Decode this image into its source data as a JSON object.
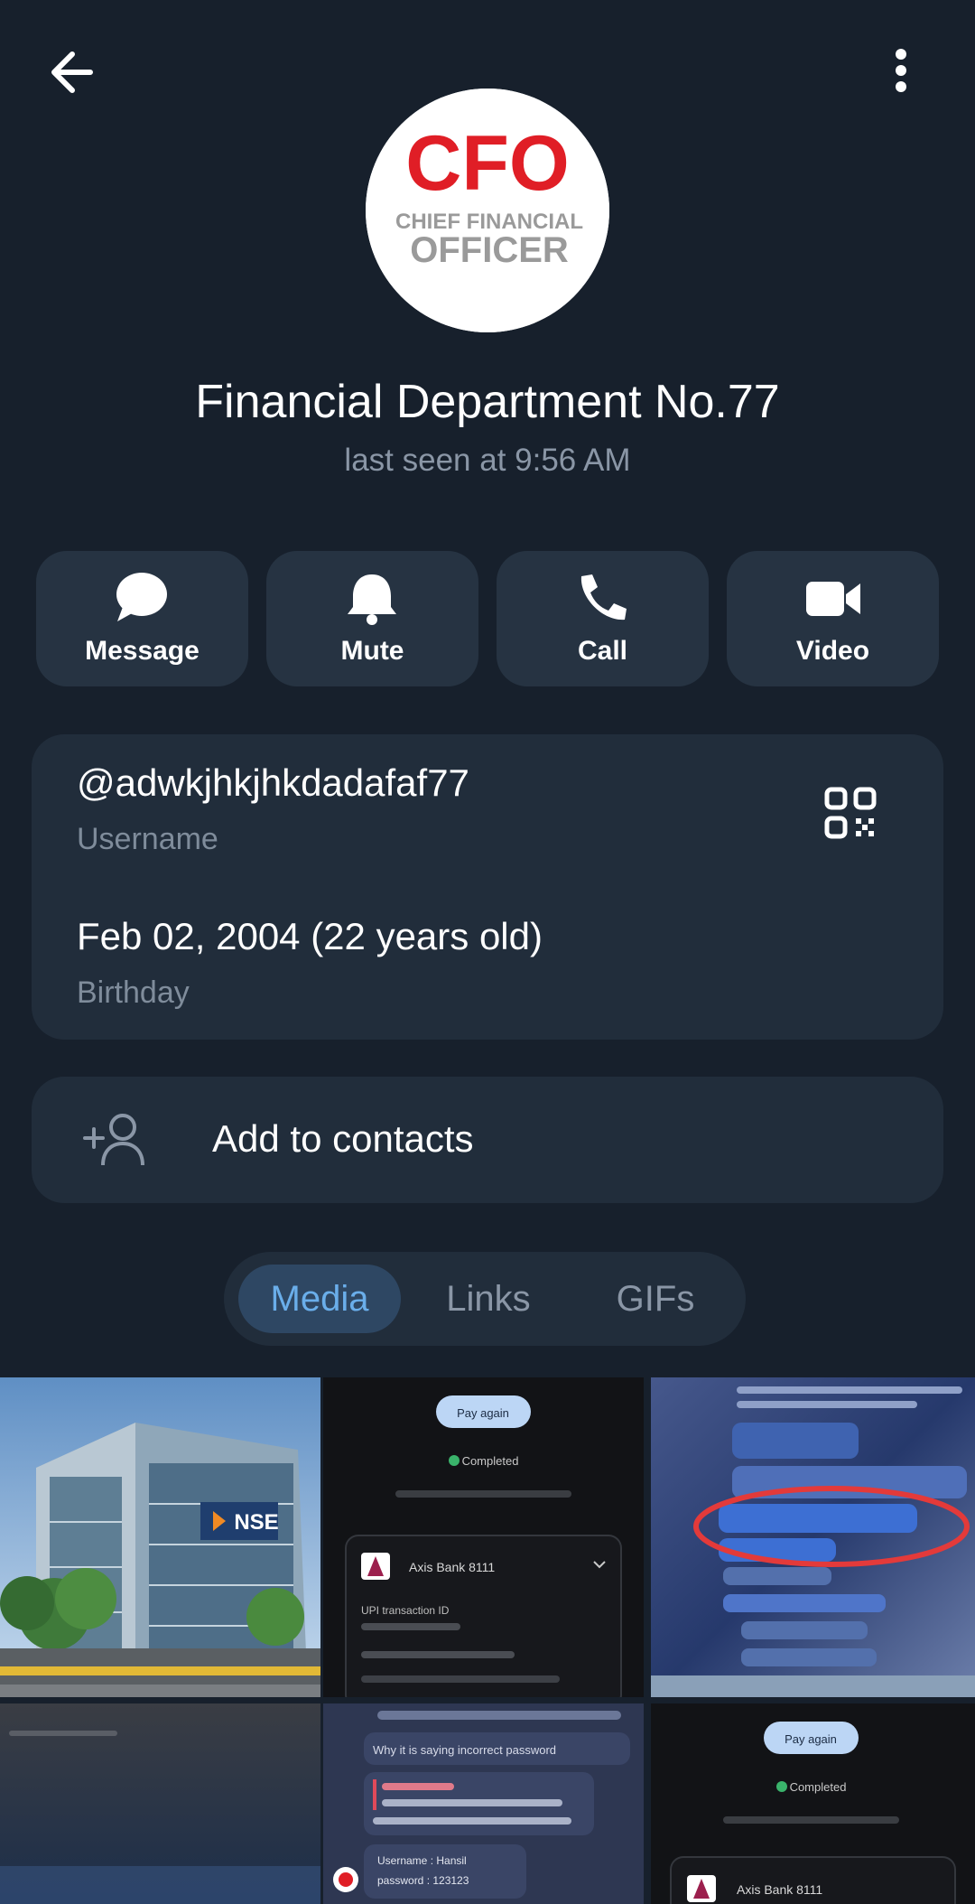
{
  "header": {
    "back_icon": "arrow-left-icon",
    "more_icon": "more-vertical-icon"
  },
  "profile": {
    "avatar": {
      "logo_main": "CFO",
      "logo_line1": "CHIEF FINANCIAL",
      "logo_line2": "OFFICER",
      "logo_color": "#e01e26"
    },
    "name": "Financial Department No.77",
    "status": "last seen at 9:56 AM"
  },
  "actions": [
    {
      "label": "Message",
      "icon": "chat-bubble-icon"
    },
    {
      "label": "Mute",
      "icon": "bell-icon"
    },
    {
      "label": "Call",
      "icon": "phone-icon"
    },
    {
      "label": "Video",
      "icon": "video-camera-icon"
    }
  ],
  "info": {
    "username": "@adwkjhkjhkdadafaf77",
    "username_label": "Username",
    "birthday": "Feb 02, 2004 (22 years old)",
    "birthday_label": "Birthday",
    "qr_icon": "qr-code-icon"
  },
  "contacts": {
    "label": "Add to contacts",
    "icon": "add-person-icon"
  },
  "tabs": [
    {
      "label": "Media",
      "active": true
    },
    {
      "label": "Links",
      "active": false
    },
    {
      "label": "GIFs",
      "active": false
    }
  ],
  "media": {
    "nse_sign": "NSE",
    "pay_again": "Pay again",
    "completed": "Completed",
    "bank": "Axis Bank 8111",
    "upi_label": "UPI transaction ID",
    "chat_incorrect": "Why it is saying incorrect password",
    "chat_username": "Username : Hansil",
    "chat_password": "password : 123123"
  },
  "colors": {
    "background": "#17202c",
    "card": "#212d3b",
    "accent": "#6aaeea"
  }
}
